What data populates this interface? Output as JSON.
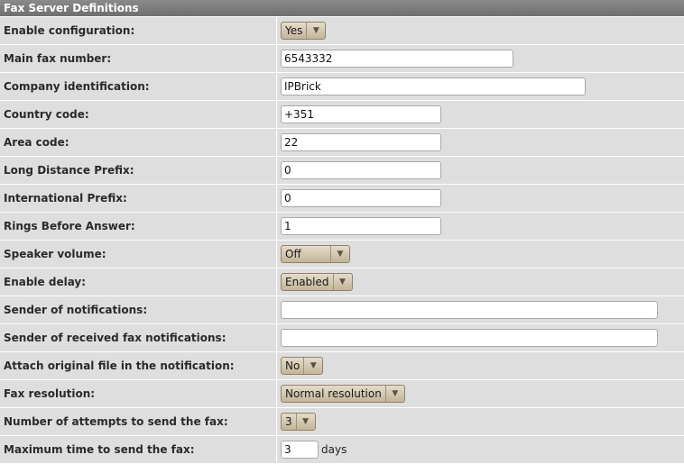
{
  "title": "Fax Server Definitions",
  "fields": {
    "enable_configuration": {
      "label": "Enable configuration:",
      "value": "Yes"
    },
    "main_fax_number": {
      "label": "Main fax number:",
      "value": "6543332"
    },
    "company_identification": {
      "label": "Company identification:",
      "value": "IPBrick"
    },
    "country_code": {
      "label": "Country code:",
      "value": "+351"
    },
    "area_code": {
      "label": "Area code:",
      "value": "22"
    },
    "long_distance_prefix": {
      "label": "Long Distance Prefix:",
      "value": "0"
    },
    "international_prefix": {
      "label": "International Prefix:",
      "value": "0"
    },
    "rings_before_answer": {
      "label": "Rings Before Answer:",
      "value": "1"
    },
    "speaker_volume": {
      "label": "Speaker volume:",
      "value": "Off"
    },
    "enable_delay": {
      "label": "Enable delay:",
      "value": "Enabled"
    },
    "sender_of_notifications": {
      "label": "Sender of notifications:",
      "value": ""
    },
    "sender_of_received_fax_notifications": {
      "label": "Sender of received fax notifications:",
      "value": ""
    },
    "attach_original_file": {
      "label": "Attach original file in the notification:",
      "value": "No"
    },
    "fax_resolution": {
      "label": "Fax resolution:",
      "value": "Normal resolution"
    },
    "number_of_attempts": {
      "label": "Number of attempts to send the fax:",
      "value": "3"
    },
    "maximum_time": {
      "label": "Maximum time to send the fax:",
      "value": "3",
      "unit": "days"
    }
  },
  "icons": {
    "select_arrow": "triangle-down-icon"
  }
}
